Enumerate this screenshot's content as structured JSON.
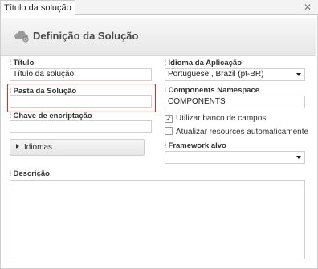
{
  "window": {
    "tab_title": "Título da solução",
    "close_glyph": "✕"
  },
  "header": {
    "title": "Definição da Solução",
    "icon": "cloud-gear-icon"
  },
  "fields": {
    "titulo": {
      "label": "Título",
      "value": "Título da solução"
    },
    "pasta": {
      "label": "Pasta da Solução",
      "value": ""
    },
    "chave": {
      "label": "Chave de encriptação",
      "value": ""
    },
    "idioma": {
      "label": "Idioma da Aplicação",
      "value": "Portuguese , Brazil (pt-BR)"
    },
    "namespace": {
      "label": "Components Namespace",
      "value": "COMPONENTS"
    },
    "framework": {
      "label": "Framework alvo",
      "value": ""
    },
    "descricao": {
      "label": "Descrição",
      "value": ""
    }
  },
  "idiomas_button": {
    "label": "Idiomas"
  },
  "checkboxes": {
    "banco": {
      "label": "Utilizar banco de campos",
      "checked": true
    },
    "resources": {
      "label": "Atualizar resources automaticamente",
      "checked": false
    }
  },
  "label_marker": "⁞",
  "check_glyph": "✓",
  "colors": {
    "highlight": "#d4312f"
  }
}
